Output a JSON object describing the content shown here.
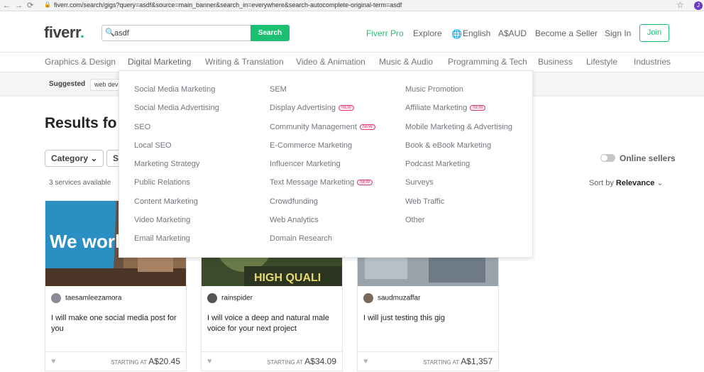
{
  "browser": {
    "url": "fiverr.com/search/gigs?query=asdf&source=main_banner&search_in=everywhere&search-autocomplete-original-term=asdf",
    "profile_initial": "J"
  },
  "header": {
    "logo_text": "fiverr",
    "logo_dot": ".",
    "search_value": "asdf",
    "search_button": "Search",
    "nav": [
      "Fiverr Pro",
      "Explore",
      "English",
      "A$AUD",
      "Become a Seller",
      "Sign In"
    ],
    "join": "Join"
  },
  "categories": [
    "Graphics & Design",
    "Digital Marketing",
    "Writing & Translation",
    "Video & Animation",
    "Music & Audio",
    "Programming & Tech",
    "Business",
    "Lifestyle",
    "Industries"
  ],
  "suggested": {
    "label": "Suggested",
    "chip": "web dev"
  },
  "results": {
    "title": "Results fo",
    "category_filter": "Category",
    "second_filter": "Se",
    "count": "3 services available",
    "online_sellers": "Online sellers",
    "sort_prefix": "Sort by",
    "sort_value": "Relevance"
  },
  "mega_menu": {
    "col1": [
      "Social Media Marketing",
      "Social Media Advertising",
      "SEO",
      "Local SEO",
      "Marketing Strategy",
      "Public Relations",
      "Content Marketing",
      "Video Marketing",
      "Email Marketing"
    ],
    "col2": [
      "SEM",
      "Display Advertising",
      "Community Management",
      "E-Commerce Marketing",
      "Influencer Marketing",
      "Text Message Marketing",
      "Crowdfunding",
      "Web Analytics",
      "Domain Research"
    ],
    "col3": [
      "Music Promotion",
      "Affiliate Marketing",
      "Mobile Marketing & Advertising",
      "Book & eBook Marketing",
      "Podcast Marketing",
      "Surveys",
      "Web Traffic",
      "Other"
    ],
    "new_badge": "NEW"
  },
  "gigs": [
    {
      "seller": "taesamleezamora",
      "title": "I will make one social media post for you",
      "starting_label": "STARTING AT",
      "price": "A$20.45",
      "image_text": "We work."
    },
    {
      "seller": "rainspider",
      "title": "I will voice a deep and natural male voice for your next project",
      "starting_label": "STARTING AT",
      "price": "A$34.09",
      "image_text": "HIGH QUALI"
    },
    {
      "seller": "saudmuzaffar",
      "title": "I will just testing this gig",
      "starting_label": "STARTING AT",
      "price": "A$1,357",
      "image_text": ""
    }
  ]
}
